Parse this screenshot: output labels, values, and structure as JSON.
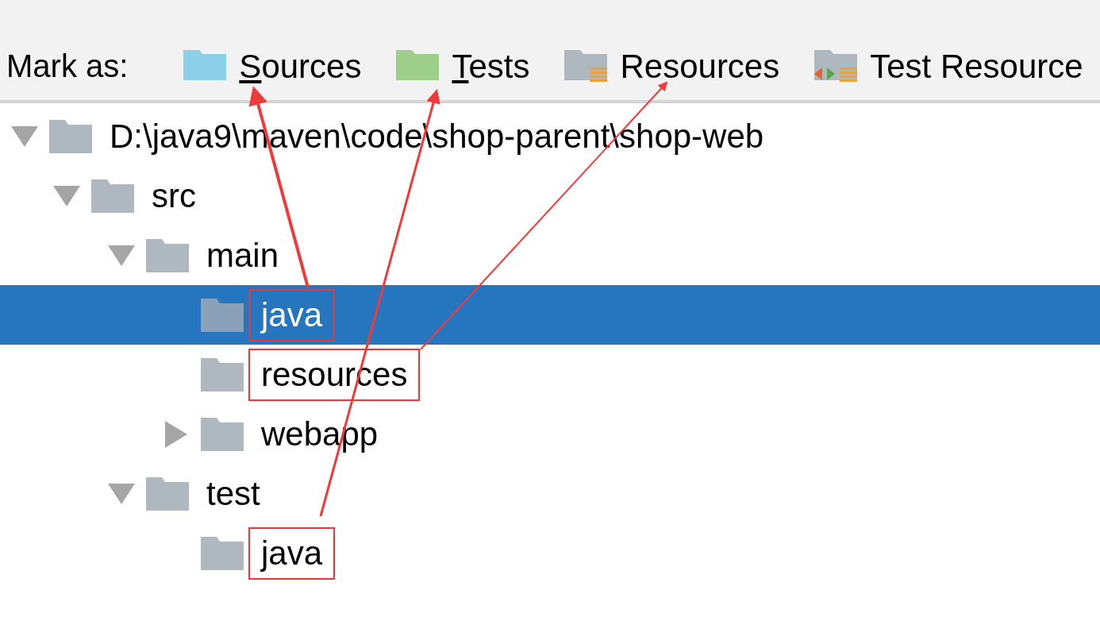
{
  "toolbar": {
    "label": "Mark as:",
    "buttons": [
      {
        "kind": "sources",
        "label": "Sources",
        "mnemonic": true
      },
      {
        "kind": "tests",
        "label": "Tests",
        "mnemonic": true
      },
      {
        "kind": "resources",
        "label": "Resources",
        "mnemonic": false
      },
      {
        "kind": "test_resources",
        "label": "Test Resource",
        "mnemonic": false
      }
    ]
  },
  "tree": [
    {
      "label": "D:\\java9\\maven\\code\\shop-parent\\shop-web",
      "expanded": true,
      "selected": false,
      "highlighted": false,
      "children": [
        {
          "label": "src",
          "expanded": true,
          "selected": false,
          "highlighted": false,
          "children": [
            {
              "label": "main",
              "expanded": true,
              "selected": false,
              "highlighted": false,
              "children": [
                {
                  "label": "java",
                  "selected": true,
                  "highlighted": true
                },
                {
                  "label": "resources",
                  "selected": false,
                  "highlighted": true
                },
                {
                  "label": "webapp",
                  "expanded": false,
                  "selected": false,
                  "highlighted": false
                }
              ]
            },
            {
              "label": "test",
              "expanded": true,
              "selected": false,
              "highlighted": false,
              "children": [
                {
                  "label": "java",
                  "selected": false,
                  "highlighted": true
                }
              ]
            }
          ]
        }
      ]
    }
  ]
}
